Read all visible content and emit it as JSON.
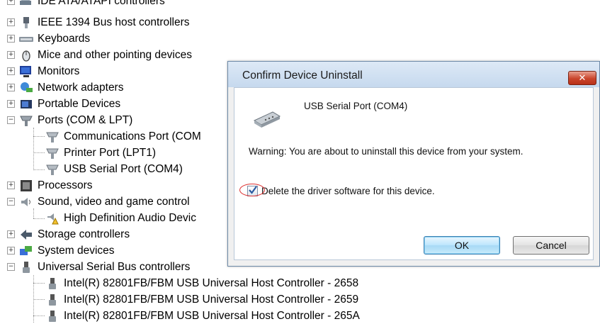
{
  "device_tree": {
    "categories": [
      {
        "label": "IDE ATA/ATAPI controllers",
        "expander": "+",
        "icon": "ide-controller-icon"
      },
      {
        "label": "IEEE 1394 Bus host controllers",
        "expander": "+",
        "icon": "ieee1394-icon"
      },
      {
        "label": "Keyboards",
        "expander": "+",
        "icon": "keyboard-icon"
      },
      {
        "label": "Mice and other pointing devices",
        "expander": "+",
        "icon": "mouse-icon"
      },
      {
        "label": "Monitors",
        "expander": "+",
        "icon": "monitor-icon"
      },
      {
        "label": "Network adapters",
        "expander": "+",
        "icon": "network-adapter-icon"
      },
      {
        "label": "Portable Devices",
        "expander": "+",
        "icon": "portable-device-icon"
      },
      {
        "label": "Ports (COM & LPT)",
        "expander": "−",
        "icon": "port-icon"
      },
      {
        "label": "Processors",
        "expander": "+",
        "icon": "processor-icon"
      },
      {
        "label": "Sound, video and game control",
        "expander": "−",
        "icon": "speaker-icon"
      },
      {
        "label": "Storage controllers",
        "expander": "+",
        "icon": "storage-icon"
      },
      {
        "label": "System devices",
        "expander": "+",
        "icon": "system-devices-icon"
      },
      {
        "label": "Universal Serial Bus controllers",
        "expander": "−",
        "icon": "usb-plug-icon"
      }
    ],
    "ports_children": [
      {
        "label": "Communications Port (COM",
        "icon": "port-icon"
      },
      {
        "label": "Printer Port (LPT1)",
        "icon": "port-icon"
      },
      {
        "label": "USB Serial Port (COM4)",
        "icon": "port-icon"
      }
    ],
    "sound_children": [
      {
        "label": "High Definition Audio Devic",
        "icon": "audio-device-warning-icon"
      }
    ],
    "usb_children": [
      {
        "label": "Intel(R) 82801FB/FBM USB Universal Host Controller - 2658",
        "icon": "usb-plug-icon"
      },
      {
        "label": "Intel(R) 82801FB/FBM USB Universal Host Controller - 2659",
        "icon": "usb-plug-icon"
      },
      {
        "label": "Intel(R) 82801FB/FBM USB Universal Host Controller - 265A",
        "icon": "usb-plug-icon"
      }
    ]
  },
  "dialog": {
    "title": "Confirm Device Uninstall",
    "close_glyph": "✕",
    "device_name": "USB Serial Port (COM4)",
    "warning": "Warning: You are about to uninstall this device from your system.",
    "checkbox_label": "Delete the driver software for this device.",
    "checkbox_checked": true,
    "ok_label": "OK",
    "cancel_label": "Cancel"
  },
  "colors": {
    "titlebar": "#c6d9ee",
    "close_button": "#c9452c",
    "ok_border": "#3c7fb1",
    "annotation_ring": "#dd3333"
  }
}
